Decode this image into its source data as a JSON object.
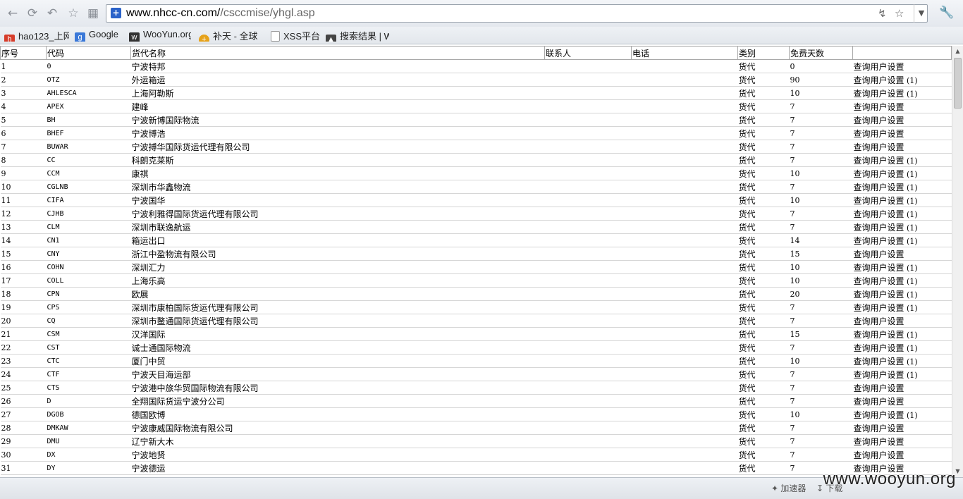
{
  "browser": {
    "url_main": "www.nhcc-cn.com/",
    "url_path": "/csccmise/yhgl.asp",
    "bookmarks": [
      "hao123_上网",
      "Google",
      "WooYun.org",
      "补天 - 全球",
      "XSS平台",
      "搜索结果 | W"
    ]
  },
  "table": {
    "headers": [
      "序号",
      "代码",
      "货代名称",
      "联系人",
      "电话",
      "类别",
      "免费天数",
      ""
    ],
    "link_label": "查询用户设置",
    "rows": [
      [
        "1",
        "0",
        "宁波特邦",
        "货代",
        "0",
        ""
      ],
      [
        "2",
        "OTZ",
        "外运箱运",
        "货代",
        "90",
        "(1)"
      ],
      [
        "3",
        "AHLESCA",
        "上海阿勒斯",
        "货代",
        "10",
        "(1)"
      ],
      [
        "4",
        "APEX",
        "建峰",
        "货代",
        "7",
        ""
      ],
      [
        "5",
        "BH",
        "宁波新博国际物流",
        "货代",
        "7",
        ""
      ],
      [
        "6",
        "BHEF",
        "宁波博浩",
        "货代",
        "7",
        ""
      ],
      [
        "7",
        "BUWAR",
        "宁波搏华国际货运代理有限公司",
        "货代",
        "7",
        ""
      ],
      [
        "8",
        "CC",
        "科朗克莱斯",
        "货代",
        "7",
        "(1)"
      ],
      [
        "9",
        "CCM",
        "康祺",
        "货代",
        "10",
        "(1)"
      ],
      [
        "10",
        "CGLNB",
        "深圳市华鑫物流",
        "货代",
        "7",
        "(1)"
      ],
      [
        "11",
        "CIFA",
        "宁波国华",
        "货代",
        "10",
        "(1)"
      ],
      [
        "12",
        "CJHB",
        "宁波利雅得国际货运代理有限公司",
        "货代",
        "7",
        "(1)"
      ],
      [
        "13",
        "CLM",
        "深圳市联逸航运",
        "货代",
        "7",
        "(1)"
      ],
      [
        "14",
        "CN1",
        "箱运出口",
        "货代",
        "14",
        "(1)"
      ],
      [
        "15",
        "CNY",
        "浙江中盈物流有限公司",
        "货代",
        "15",
        ""
      ],
      [
        "16",
        "COHN",
        "深圳汇力",
        "货代",
        "10",
        "(1)"
      ],
      [
        "17",
        "COLL",
        "上海乐高",
        "货代",
        "10",
        "(1)"
      ],
      [
        "18",
        "CPN",
        "欧展",
        "货代",
        "20",
        "(1)"
      ],
      [
        "19",
        "CPS",
        "深圳市康柏国际货运代理有限公司",
        "货代",
        "7",
        "(1)"
      ],
      [
        "20",
        "CQ",
        "深圳市鳌通国际货运代理有限公司",
        "货代",
        "7",
        ""
      ],
      [
        "21",
        "CSM",
        "汉洋国际",
        "货代",
        "15",
        "(1)"
      ],
      [
        "22",
        "CST",
        "诚士通国际物流",
        "货代",
        "7",
        "(1)"
      ],
      [
        "23",
        "CTC",
        "厦门中贸",
        "货代",
        "10",
        "(1)"
      ],
      [
        "24",
        "CTF",
        "宁波天目海运部",
        "货代",
        "7",
        "(1)"
      ],
      [
        "25",
        "CTS",
        "宁波港中旅华贸国际物流有限公司",
        "货代",
        "7",
        ""
      ],
      [
        "26",
        "D",
        "全翔国际货运宁波分公司",
        "货代",
        "7",
        ""
      ],
      [
        "27",
        "DGOB",
        "德国欧博",
        "货代",
        "10",
        "(1)"
      ],
      [
        "28",
        "DMKAW",
        "宁波康威国际物流有限公司",
        "货代",
        "7",
        ""
      ],
      [
        "29",
        "DMU",
        "辽宁新大木",
        "货代",
        "7",
        ""
      ],
      [
        "30",
        "DX",
        "宁波地贤",
        "货代",
        "7",
        ""
      ],
      [
        "31",
        "DY",
        "宁波德运",
        "货代",
        "7",
        ""
      ]
    ]
  },
  "statusbar": {
    "accelerator": "加速器",
    "download": "下载",
    "watermark": "www.wooyun.org"
  }
}
